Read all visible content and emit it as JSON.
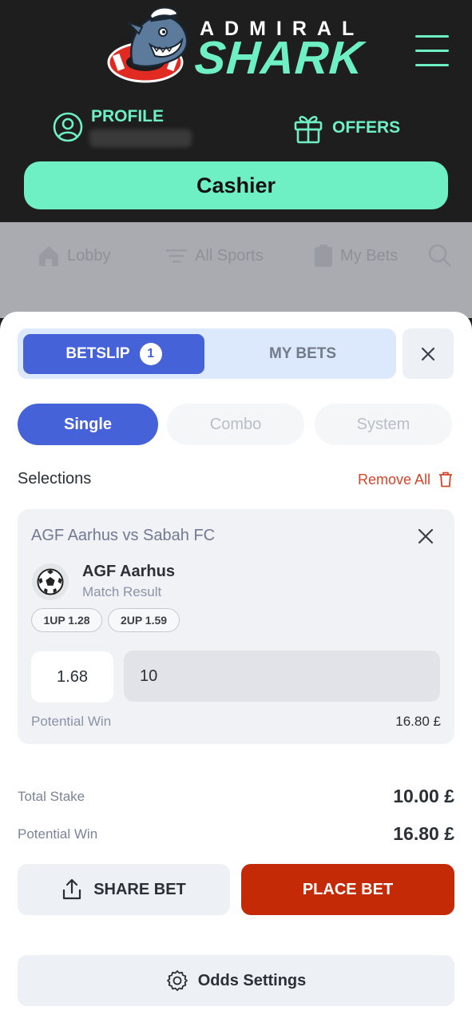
{
  "header": {
    "logo_top": "ADMIRAL",
    "logo_main": "SHARK",
    "profile_label": "PROFILE",
    "offers_label": "OFFERS",
    "cashier_label": "Cashier",
    "brand_color": "#6ff0c4"
  },
  "subnav": {
    "items": [
      {
        "label": "Lobby",
        "icon": "home-icon"
      },
      {
        "label": "All Sports",
        "icon": "filter-icon"
      },
      {
        "label": "My Bets",
        "icon": "clipboard-icon"
      }
    ]
  },
  "betslip": {
    "tabs": {
      "betslip_label": "BETSLIP",
      "betslip_count": "1",
      "mybets_label": "MY BETS"
    },
    "bet_types": {
      "single": "Single",
      "combo": "Combo",
      "system": "System",
      "selected": "Single"
    },
    "selections_label": "Selections",
    "remove_all_label": "Remove All",
    "selection": {
      "match": "AGF Aarhus vs Sabah FC",
      "pick": "AGF Aarhus",
      "market": "Match Result",
      "chip_1": "1UP 1.28",
      "chip_2": "2UP 1.59",
      "odds": "1.68",
      "stake": "10",
      "potential_win_label": "Potential Win",
      "potential_win_value": "16.80 £"
    },
    "summary": {
      "total_stake_label": "Total Stake",
      "total_stake_value": "10.00 £",
      "potential_win_label": "Potential Win",
      "potential_win_value": "16.80 £"
    },
    "share_label": "SHARE BET",
    "place_label": "PLACE BET",
    "odds_settings_label": "Odds Settings",
    "accent_color": "#4662d8",
    "place_color": "#c42a06"
  }
}
